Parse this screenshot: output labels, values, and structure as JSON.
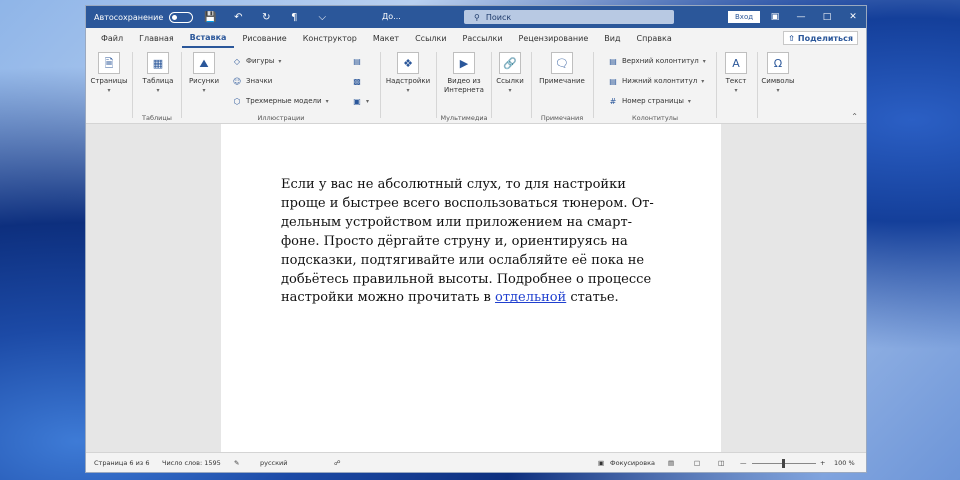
{
  "titlebar": {
    "autosave_label": "Автосохранение",
    "doc_title": "До...",
    "search_placeholder": "Поиск",
    "login_label": "Вход"
  },
  "menu": {
    "tabs": [
      "Файл",
      "Главная",
      "Вставка",
      "Рисование",
      "Конструктор",
      "Макет",
      "Ссылки",
      "Рассылки",
      "Рецензирование",
      "Вид",
      "Справка"
    ],
    "active": "Вставка",
    "share_label": "Поделиться"
  },
  "ribbon": {
    "pages": "Страницы",
    "table": "Таблица",
    "tables_group": "Таблицы",
    "pictures": "Рисунки",
    "shapes": "Фигуры",
    "icons": "Значки",
    "models3d": "Трехмерные модели",
    "illustrations_group": "Иллюстрации",
    "addins": "Надстройки",
    "video": "Видео из Интернета",
    "media_group": "Мультимедиа",
    "links": "Ссылки",
    "comment": "Примечание",
    "comments_group": "Примечания",
    "header": "Верхний колонтитул",
    "footer": "Нижний колонтитул",
    "page_number": "Номер страницы",
    "hf_group": "Колонтитулы",
    "text": "Текст",
    "symbols": "Символы"
  },
  "document": {
    "lines": [
      "Если у вас не абсолютный слух, то для настройки",
      "проще и быстрее всего воспользоваться тюнером. От-",
      "дельным устройством или приложением на смарт-",
      "фоне. Просто дёргайте струну и, ориентируясь на",
      "подсказки, подтягивайте или ослабляйте её пока не",
      "добьётесь правильной высоты. Подробнее о процессе"
    ],
    "last_line_before": "настройки можно прочитать в ",
    "link_text": "отдельной",
    "last_line_after": " статье."
  },
  "status": {
    "page": "Страница 6 из 6",
    "words": "Число слов: 1595",
    "language": "русский",
    "focus": "Фокусировка",
    "zoom": "100 %"
  }
}
